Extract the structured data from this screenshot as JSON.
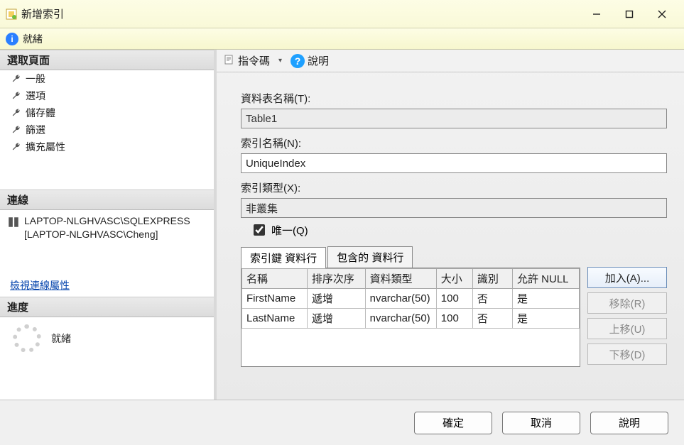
{
  "window": {
    "title": "新增索引",
    "minimize_tooltip": "Minimize",
    "maximize_tooltip": "Maximize",
    "close_tooltip": "Close"
  },
  "status": {
    "text": "就緒"
  },
  "sidebar": {
    "pages_header": "選取頁面",
    "pages": [
      {
        "label": "一般"
      },
      {
        "label": "選項"
      },
      {
        "label": "儲存體"
      },
      {
        "label": "篩選"
      },
      {
        "label": "擴充屬性"
      }
    ],
    "connection_header": "連線",
    "connection_text": "LAPTOP-NLGHVASC\\SQLEXPRESS [LAPTOP-NLGHVASC\\Cheng]",
    "view_connection_link": "檢視連線屬性",
    "progress_header": "進度",
    "progress_text": "就緒"
  },
  "toolbar": {
    "script_label": "指令碼",
    "help_label": "說明"
  },
  "form": {
    "table_name_label": "資料表名稱(T):",
    "table_name_value": "Table1",
    "index_name_label": "索引名稱(N):",
    "index_name_value": "UniqueIndex",
    "index_type_label": "索引類型(X):",
    "index_type_value": "非叢集",
    "unique_label": "唯一(Q)",
    "unique_checked": true
  },
  "tabs": {
    "key_columns": "索引鍵 資料行",
    "included_columns": "包含的 資料行"
  },
  "grid": {
    "headers": {
      "name": "名稱",
      "sort": "排序次序",
      "type": "資料類型",
      "size": "大小",
      "identity": "識別",
      "allow_null": "允許 NULL"
    },
    "rows": [
      {
        "name": "FirstName",
        "sort": "遞增",
        "type": "nvarchar(50)",
        "size": "100",
        "identity": "否",
        "allow_null": "是"
      },
      {
        "name": "LastName",
        "sort": "遞增",
        "type": "nvarchar(50)",
        "size": "100",
        "identity": "否",
        "allow_null": "是"
      }
    ]
  },
  "grid_buttons": {
    "add": "加入(A)...",
    "remove": "移除(R)",
    "move_up": "上移(U)",
    "move_down": "下移(D)"
  },
  "footer": {
    "ok": "確定",
    "cancel": "取消",
    "help": "說明"
  }
}
